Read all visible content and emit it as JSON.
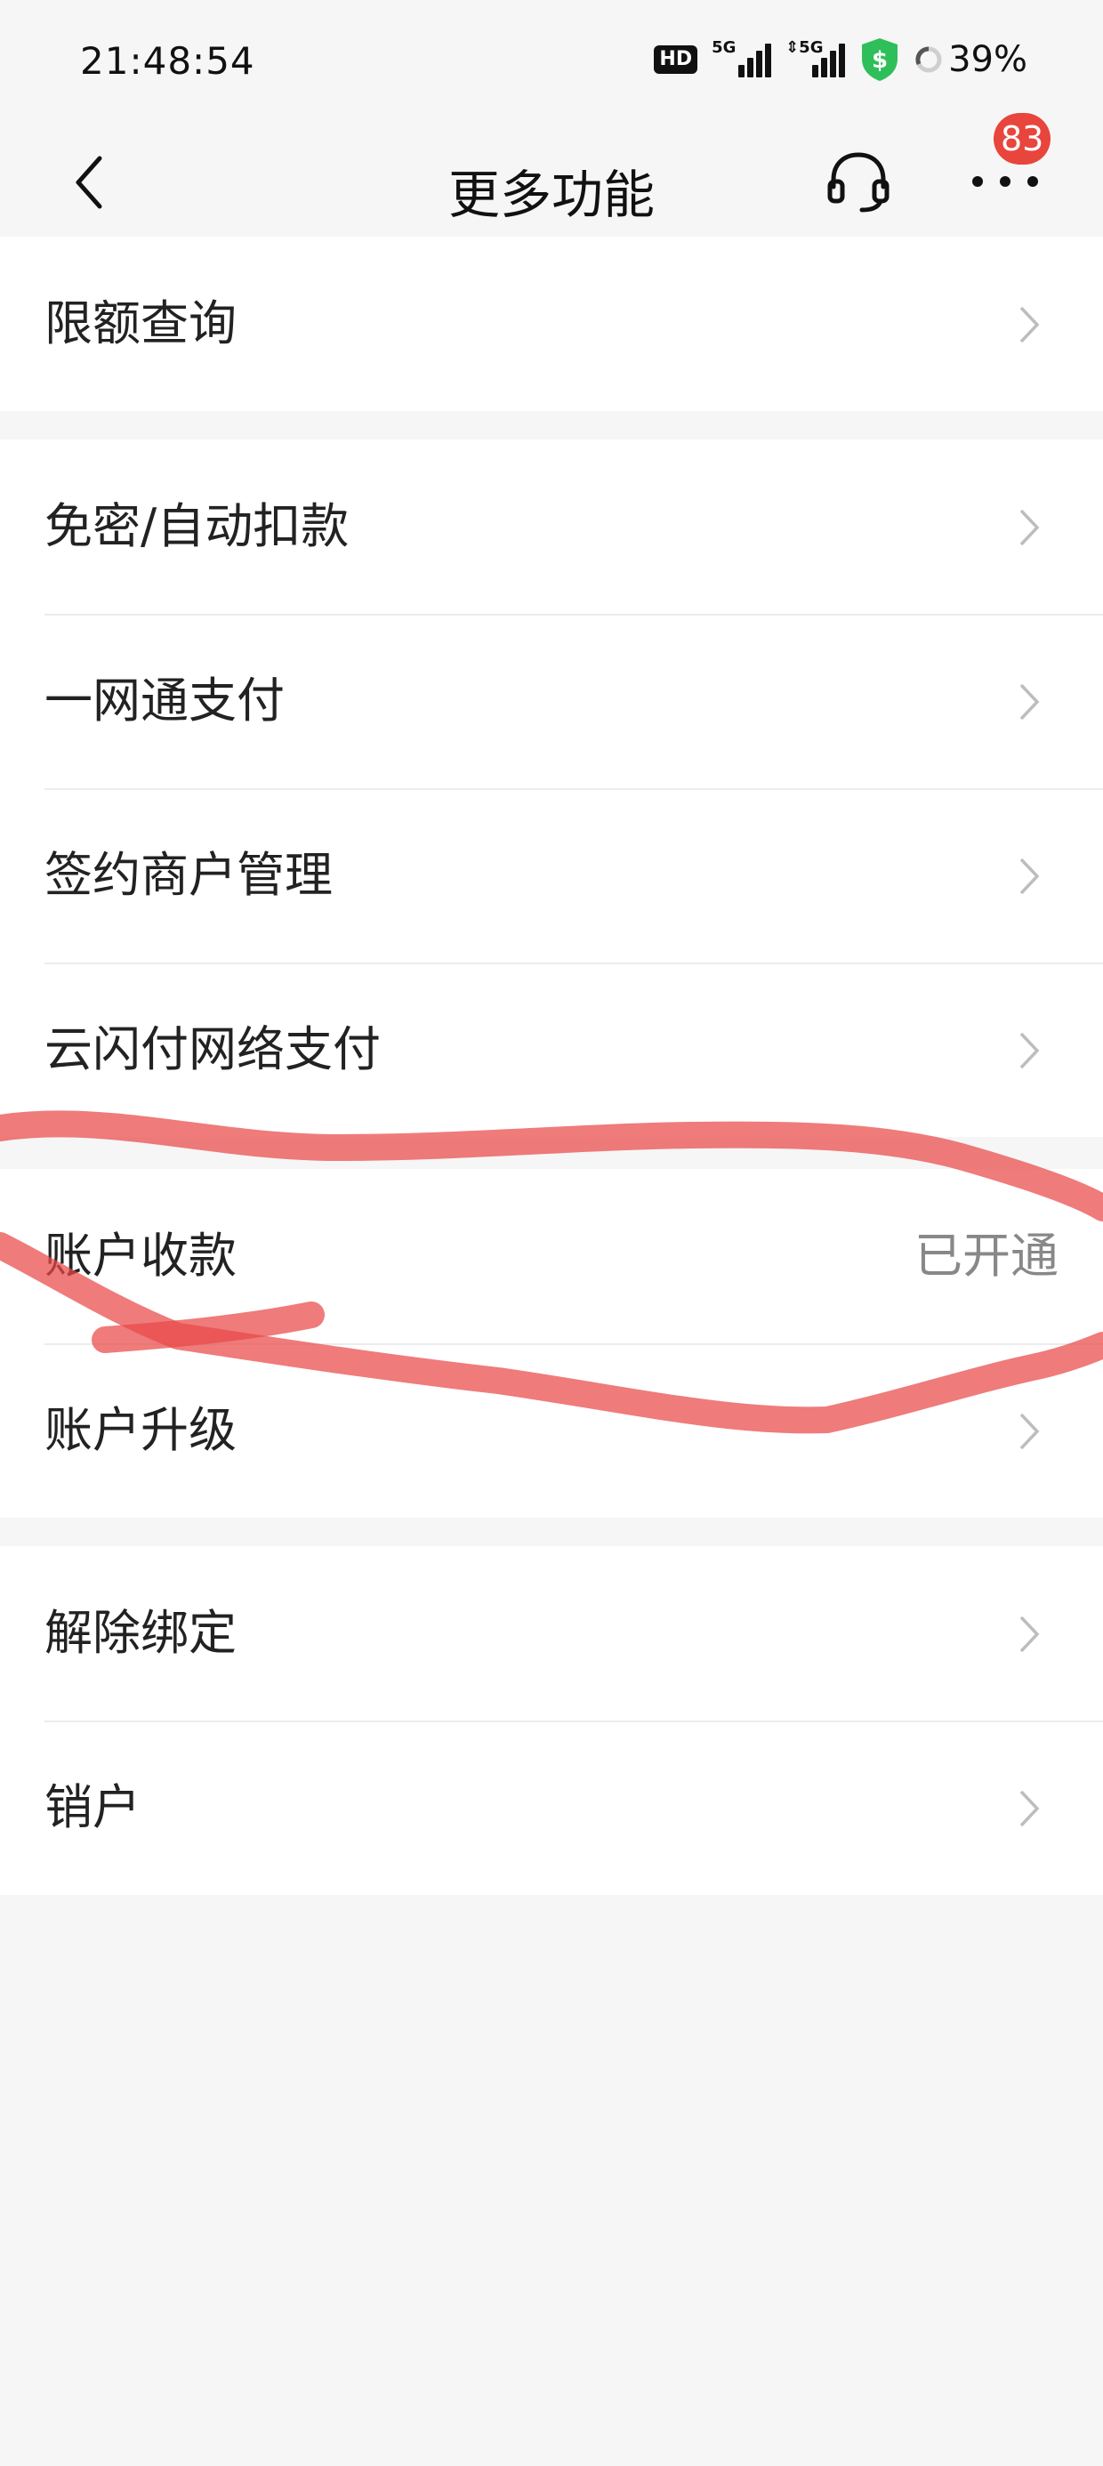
{
  "status_bar": {
    "time": "21:48:54",
    "hd_label": "HD",
    "signal1_label": "5G",
    "signal2_label": "⇕5G",
    "battery_percent": "39%"
  },
  "nav": {
    "title": "更多功能",
    "badge_count": "83",
    "icons": [
      "back-icon",
      "headset-icon",
      "more-icon"
    ]
  },
  "groups": [
    {
      "items": [
        {
          "label": "限额查询"
        }
      ]
    },
    {
      "items": [
        {
          "label": "免密/自动扣款"
        },
        {
          "label": "一网通支付"
        },
        {
          "label": "签约商户管理"
        },
        {
          "label": "云闪付网络支付"
        }
      ]
    },
    {
      "items": [
        {
          "label": "账户收款",
          "value": "已开通"
        },
        {
          "label": "账户升级"
        }
      ]
    },
    {
      "items": [
        {
          "label": "解除绑定"
        },
        {
          "label": "销户"
        }
      ]
    }
  ],
  "colors": {
    "background": "#f6f6f6",
    "badge": "#e8453c",
    "annotation": "#e94848",
    "shield": "#2fbf5a"
  }
}
